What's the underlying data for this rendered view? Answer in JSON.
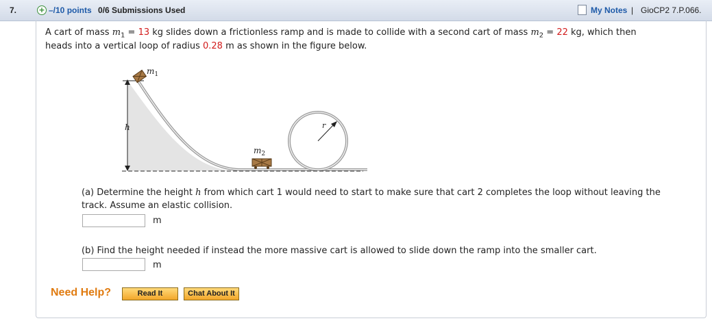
{
  "header": {
    "question_number": "7.",
    "points": "–/10 points",
    "submissions": "0/6 Submissions Used",
    "my_notes": "My Notes",
    "separator": "|",
    "question_id": "GioCP2 7.P.066."
  },
  "problem": {
    "line1_a": "A cart of mass ",
    "m1_var": "m",
    "m1_sub": "1",
    "eq": " = ",
    "m1_value": "13",
    "line1_b": " kg slides down a frictionless ramp and is made to collide with a second cart of mass ",
    "m2_var": "m",
    "m2_sub": "2",
    "m2_value": "22",
    "line1_c": " kg,  which then",
    "line2_a": "heads into a vertical loop of radius ",
    "radius_value": "0.28",
    "line2_b": " m as shown in the figure below."
  },
  "figure": {
    "m1_label": "m",
    "m1_sub": "1",
    "m2_label": "m",
    "m2_sub": "2",
    "h_label": "h",
    "r_label": "r"
  },
  "part_a": {
    "line1_a": "(a) Determine the height ",
    "h_var": "h",
    "line1_b": " from which cart 1 would need to start to make sure that cart 2 completes the loop without leaving the",
    "line2": "track. Assume an elastic collision.",
    "unit": "m",
    "value": ""
  },
  "part_b": {
    "text": "(b) Find the height needed if instead the more massive cart is allowed to slide down the ramp into the smaller cart.",
    "unit": "m",
    "value": ""
  },
  "help": {
    "label": "Need Help?",
    "read_it": "Read It",
    "chat": "Chat About It"
  },
  "colors": {
    "link_blue": "#1e5aa8",
    "value_red": "#d21b1b",
    "help_orange": "#e07b10"
  }
}
